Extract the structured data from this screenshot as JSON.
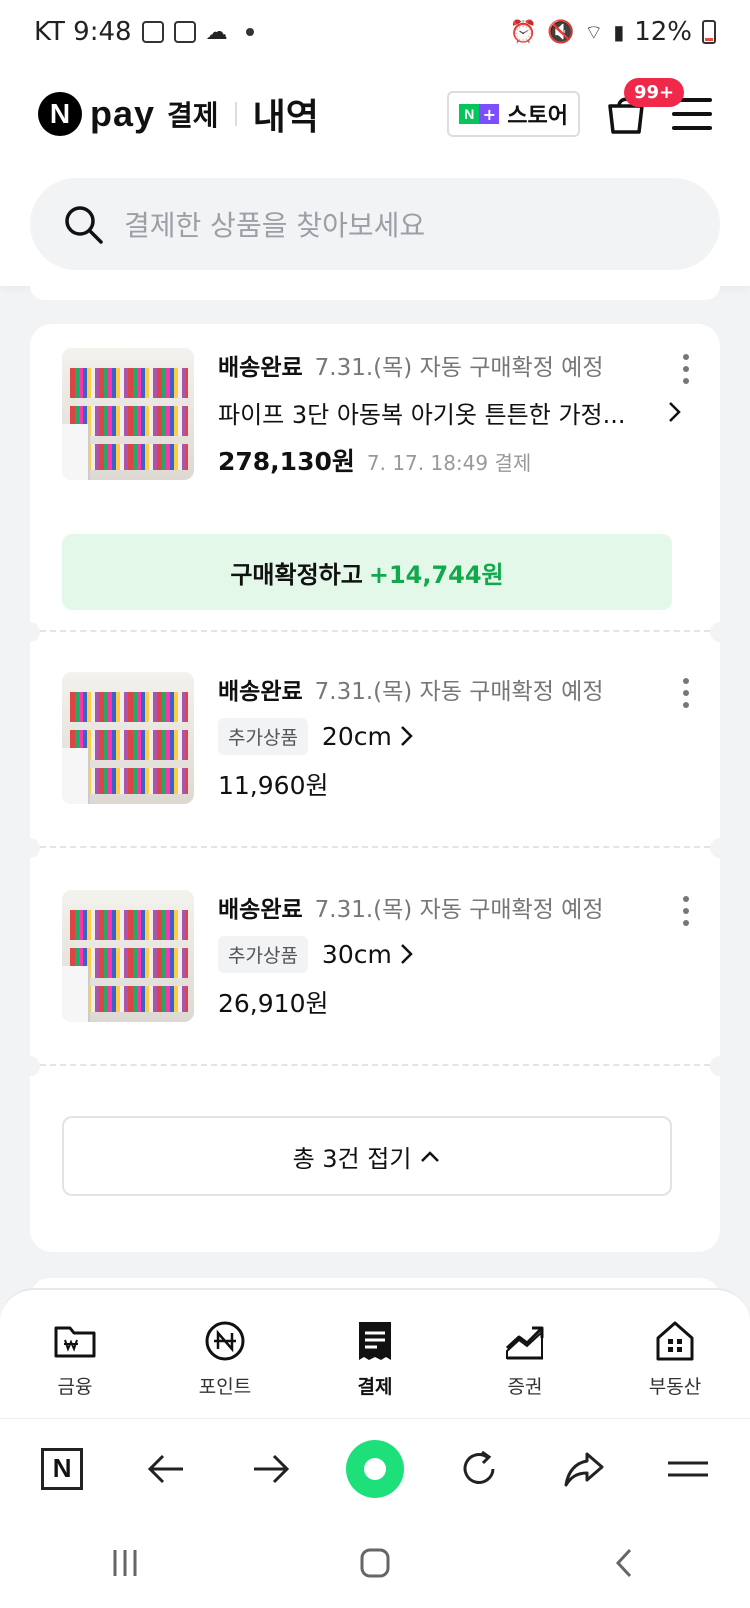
{
  "status_bar": {
    "carrier_time": "KT 9:48",
    "battery": "12%"
  },
  "header": {
    "brand_n": "N",
    "brand_pay": "pay",
    "section": "결제",
    "title": "내역",
    "store_label": "스토어",
    "cart_badge": "99+"
  },
  "search": {
    "placeholder": "결제한 상품을 찾아보세요"
  },
  "order": {
    "items": [
      {
        "status": "배송완료",
        "schedule": "7.31.(목) 자동 구매확정 예정",
        "name": "파이프 3단 아동복 아기옷 튼튼한 가정...",
        "price": "278,130원",
        "paid_at": "7. 17. 18:49 결제"
      },
      {
        "status": "배송완료",
        "schedule": "7.31.(목) 자동 구매확정 예정",
        "addon_tag": "추가상품",
        "option": "20cm",
        "price": "11,960원"
      },
      {
        "status": "배송완료",
        "schedule": "7.31.(목) 자동 구매확정 예정",
        "addon_tag": "추가상품",
        "option": "30cm",
        "price": "26,910원"
      }
    ],
    "confirm_label": "구매확정하고",
    "confirm_points": "+14,744원",
    "fold_label": "총 3건 접기"
  },
  "app_nav": [
    {
      "label": "금융",
      "icon": "finance-folder-icon"
    },
    {
      "label": "포인트",
      "icon": "point-coin-icon"
    },
    {
      "label": "결제",
      "icon": "payment-receipt-icon",
      "active": true
    },
    {
      "label": "증권",
      "icon": "stock-chart-icon"
    },
    {
      "label": "부동산",
      "icon": "real-estate-building-icon"
    }
  ],
  "browser_home_label": "N",
  "colors": {
    "accent_green": "#12a84b",
    "confirm_bg": "#e3f8e9",
    "badge_red": "#f02849",
    "naver_green": "#03c75a"
  }
}
